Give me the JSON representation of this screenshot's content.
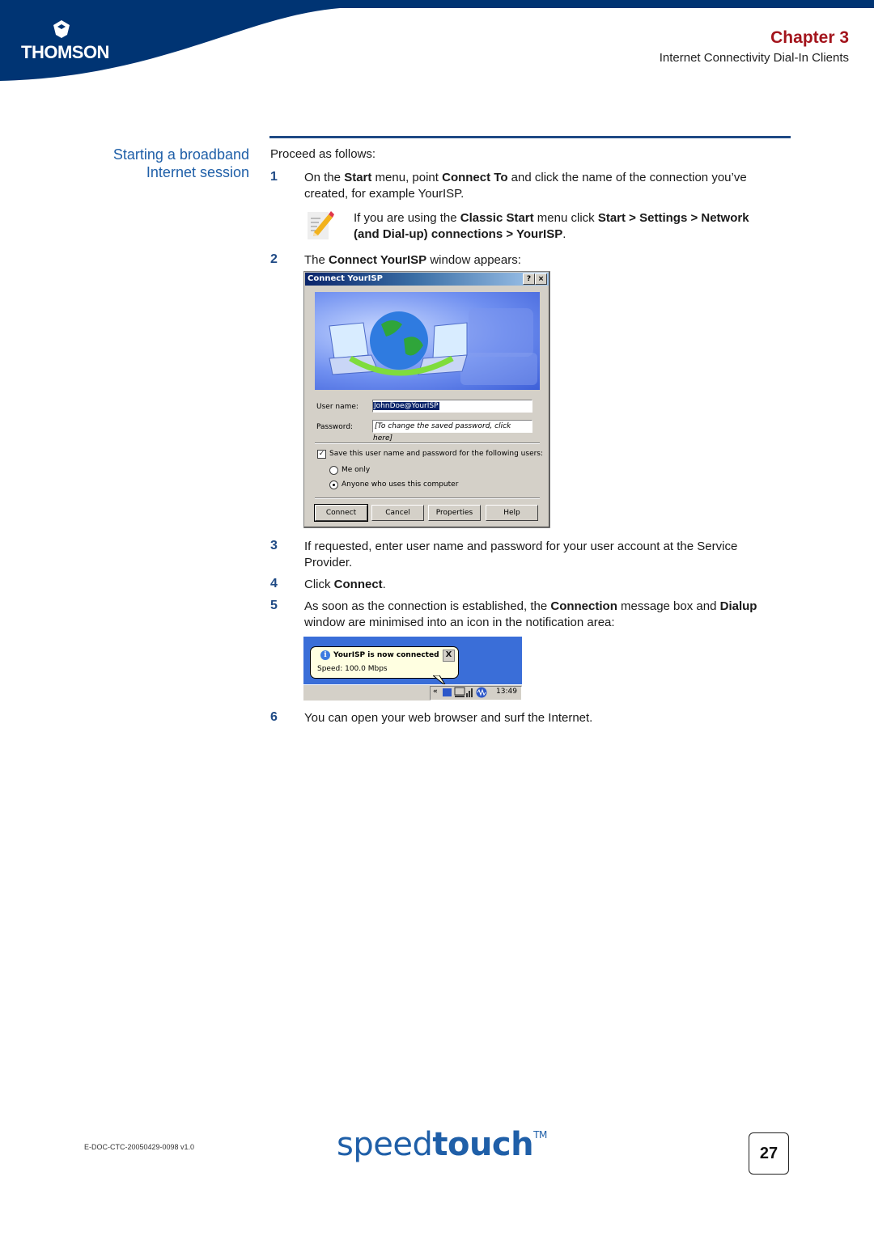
{
  "header": {
    "brand_name": "THOMSON",
    "chapter_label": "Chapter 3",
    "chapter_subtitle": "Internet Connectivity Dial-In Clients",
    "band_color": "#003473",
    "chapter_color": "#a3141c"
  },
  "section": {
    "heading_line1": "Starting a broadband",
    "heading_line2": "Internet session",
    "intro": "Proceed as follows:"
  },
  "steps": [
    {
      "num": "1",
      "parts": [
        "On the ",
        "Start",
        " menu, point ",
        "Connect To",
        " and click the name of the connection you’ve created, for example YourISP."
      ]
    },
    {
      "num": "2",
      "parts": [
        "The ",
        "Connect YourISP",
        " window appears:"
      ]
    },
    {
      "num": "3",
      "parts": [
        "If requested, enter user name and password for your user account at the Service Provider."
      ]
    },
    {
      "num": "4",
      "parts": [
        "Click ",
        "Connect",
        "."
      ]
    },
    {
      "num": "5",
      "parts": [
        "As soon as the connection is established, the ",
        "Connection",
        " message box and ",
        "Dialup",
        " window are minimised into an icon in the notification area:"
      ]
    },
    {
      "num": "6",
      "parts": [
        "You can open your web browser and surf the Internet."
      ]
    }
  ],
  "note": {
    "icon": "pencil-note-icon",
    "parts": [
      "If you are using the ",
      "Classic Start",
      " menu click ",
      "Start > Settings > Network (and Dial-up) connections > YourISP",
      "."
    ]
  },
  "dialog": {
    "title": "Connect YourISP",
    "help_button": "?",
    "close_button": "×",
    "user_name_label": "User name:",
    "user_name_value": "JohnDoe@YourISP",
    "password_label": "Password:",
    "password_value": "[To change the saved password, click here]",
    "save_checkbox_label": "Save this user name and password for the following users:",
    "save_checked": true,
    "radio_me_only": "Me only",
    "radio_anyone": "Anyone who uses this computer",
    "selected_radio": "Anyone who uses this computer",
    "buttons": {
      "connect": "Connect",
      "cancel": "Cancel",
      "properties": "Properties",
      "help": "Help"
    }
  },
  "notification": {
    "title": "YourISP is now connected",
    "body": "Speed: 100.0 Mbps",
    "close": "X",
    "expand": "«",
    "clock": "13:49"
  },
  "footer": {
    "doc_id": "E-DOC-CTC-20050429-0098 v1.0",
    "brand_light": "speed",
    "brand_bold": "touch",
    "trademark": "TM",
    "page_number": "27"
  }
}
